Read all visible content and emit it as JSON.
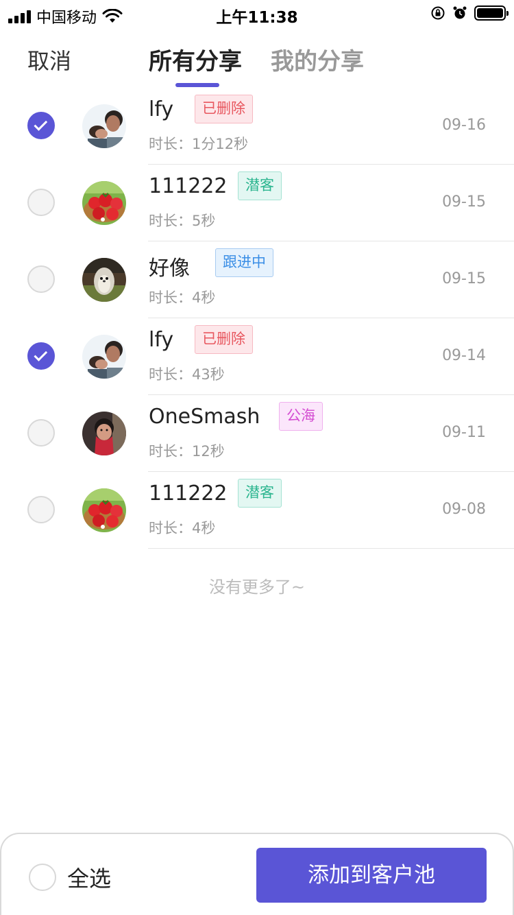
{
  "status_bar": {
    "carrier": "中国移动",
    "time": "上午11:38",
    "icons": [
      "signal-icon",
      "wifi-icon",
      "orientation-lock-icon",
      "alarm-icon",
      "battery-icon"
    ]
  },
  "header": {
    "cancel_label": "取消",
    "tabs": [
      {
        "label": "所有分享",
        "active": true
      },
      {
        "label": "我的分享",
        "active": false
      }
    ],
    "accent_color": "#5a55d6"
  },
  "shares": [
    {
      "name": "lfy",
      "tag": "已删除",
      "duration": "时长：1分12秒",
      "date": "09-16",
      "checked": true,
      "avatar": "couple-photo"
    },
    {
      "name": "111222",
      "tag": "潜客",
      "duration": "时长：5秒",
      "date": "09-15",
      "checked": false,
      "avatar": "strawberries-photo"
    },
    {
      "name": "好像",
      "tag": "跟进中",
      "duration": "时长：4秒",
      "date": "09-15",
      "checked": false,
      "avatar": "hedgehog-photo"
    },
    {
      "name": "lfy",
      "tag": "已删除",
      "duration": "时长：43秒",
      "date": "09-14",
      "checked": true,
      "avatar": "couple-photo"
    },
    {
      "name": "OneSmash",
      "tag": "公海",
      "duration": "时长：12秒",
      "date": "09-11",
      "checked": false,
      "avatar": "person-red-photo"
    },
    {
      "name": "111222",
      "tag": "潜客",
      "duration": "时长：4秒",
      "date": "09-08",
      "checked": false,
      "avatar": "strawberries-photo"
    }
  ],
  "tag_colors": {
    "已删除": "#e8575f",
    "潜客": "#2bb58f",
    "跟进中": "#3a8ee6",
    "公海": "#d44ed2"
  },
  "list_end_text": "没有更多了~",
  "footer": {
    "select_all_label": "全选",
    "add_button_label": "添加到客户池"
  }
}
